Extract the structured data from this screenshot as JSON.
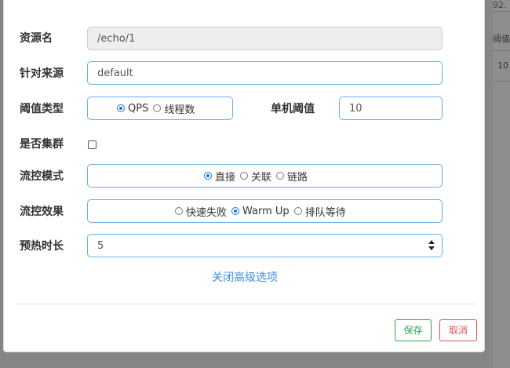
{
  "background": {
    "top_text": "92.",
    "column_header": "阈值",
    "row_value": "10"
  },
  "form": {
    "resource": {
      "label": "资源名",
      "value": "/echo/1"
    },
    "limit_app": {
      "label": "针对来源",
      "value": "default"
    },
    "grade": {
      "label": "阈值类型",
      "options": [
        "QPS",
        "线程数"
      ],
      "selected": "QPS"
    },
    "threshold": {
      "label": "单机阈值",
      "value": "10"
    },
    "cluster": {
      "label": "是否集群",
      "checked": false
    },
    "strategy": {
      "label": "流控模式",
      "options": [
        "直接",
        "关联",
        "链路"
      ],
      "selected": "直接"
    },
    "control_behavior": {
      "label": "流控效果",
      "options": [
        "快速失败",
        "Warm Up",
        "排队等待"
      ],
      "selected": "Warm Up"
    },
    "warmup": {
      "label": "预热时长",
      "value": "5"
    },
    "advanced_link": "关闭高级选项"
  },
  "footer": {
    "save_label": "保存",
    "cancel_label": "取消"
  },
  "colors": {
    "accent": "#1976d2",
    "input_border": "#66afe9",
    "save": "#2ea44f",
    "cancel": "#e05050",
    "link": "#3a8ee6"
  }
}
